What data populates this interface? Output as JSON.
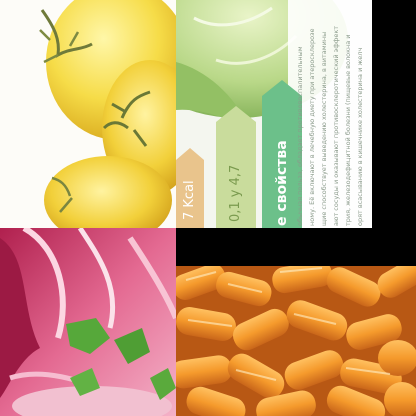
{
  "tiles": [
    {
      "name": "yellow-tomatoes-photo"
    },
    {
      "name": "cabbage-nutrition-card-photo"
    },
    {
      "name": "pickled-pink-cabbage-photo"
    },
    {
      "name": "carrot-sticks-photo"
    }
  ],
  "card": {
    "kcal_label": "7 Kcal",
    "macro_label": "0,1 у 4,7",
    "properties_label": "е свойства",
    "paragraph_lines": [
      "обычная польза, обладает противовоспалительным",
      "ному. Её включают в лечебную диету при атеросклерозе",
      "щие способствует выведению холестерина, в витамины",
      "ают сосуды и оказывают противосклеротический эффект",
      "трия, железодефицитной болезни (пищевые волокна и",
      "орят всасыванию в кишечнике холестерина и желч"
    ]
  },
  "colors": {
    "kcal_tag": "#e9c48c",
    "macro_tag": "#c9dc9c",
    "properties_tag": "#6cc08a",
    "card_text": "#8a9a8a"
  }
}
